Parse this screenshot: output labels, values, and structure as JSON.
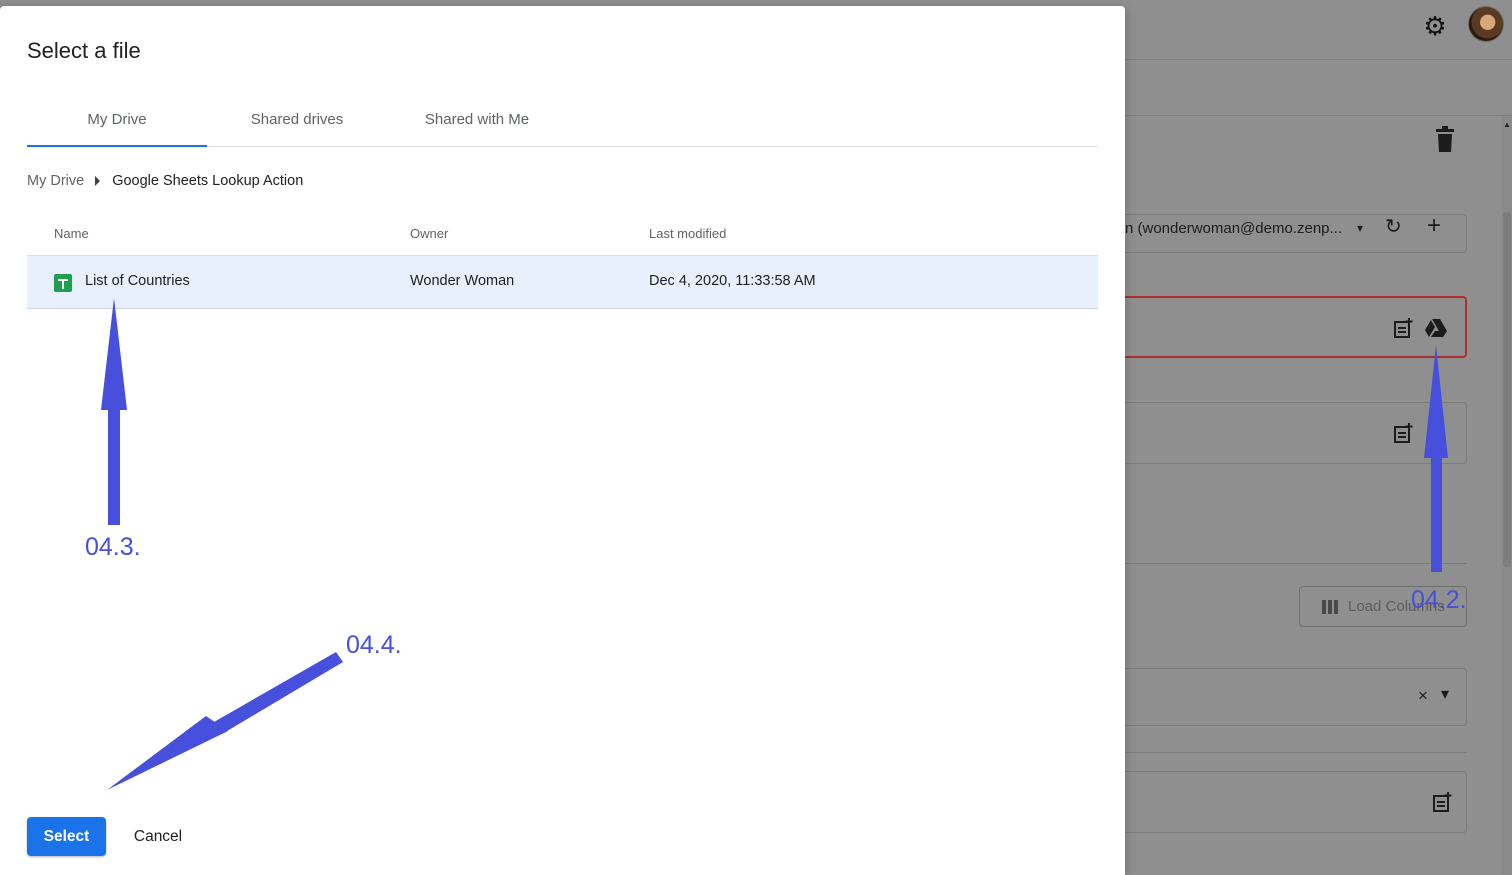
{
  "background": {
    "account_field_text": "n (wonderwoman@demo.zenp...",
    "load_columns_label": "Load Columns",
    "icons": {
      "settings": "gear-icon",
      "avatar": "avatar",
      "delete": "trash-icon",
      "refresh": "refresh-icon",
      "add": "plus-icon",
      "insert_field": "note-add-icon",
      "drive": "google-drive-icon",
      "clear": "close-icon",
      "dropdown": "caret-down-icon",
      "columns": "view-column-icon"
    },
    "glyphs": {
      "refresh": "↻",
      "add": "+",
      "clear": "×",
      "dropdown_caret": "▾",
      "settings": "⚙"
    },
    "error_border_color": "#a93030"
  },
  "dialog": {
    "title": "Select a file",
    "tabs": [
      {
        "label": "My Drive",
        "active": true
      },
      {
        "label": "Shared drives",
        "active": false
      },
      {
        "label": "Shared with Me",
        "active": false
      }
    ],
    "breadcrumb": {
      "root": "My Drive",
      "current": "Google Sheets Lookup Action"
    },
    "table": {
      "columns": [
        "Name",
        "Owner",
        "Last modified"
      ],
      "rows": [
        {
          "name": "List of Countries",
          "owner": "Wonder Woman",
          "modified": "Dec 4, 2020, 11:33:58 AM",
          "icon": "google-sheets-icon",
          "selected": true
        }
      ]
    },
    "buttons": {
      "select": "Select",
      "cancel": "Cancel"
    },
    "accent_color": "#1a73e8",
    "selected_row_color": "#e8f0fe"
  },
  "annotations": {
    "color": "#4650dc",
    "labels": [
      "04.2.",
      "04.3.",
      "04.4."
    ]
  }
}
